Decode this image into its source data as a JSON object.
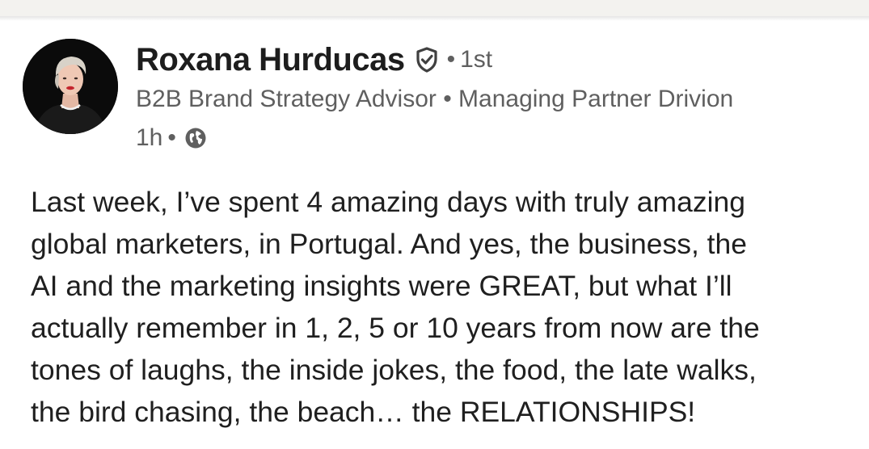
{
  "author": {
    "name": "Roxana Hurducas",
    "verified_icon": "verified-shield-icon",
    "separator": "•",
    "connection_degree": "1st",
    "headline": "B2B Brand Strategy Advisor • Managing Partner Drivion",
    "time_ago": "1h",
    "meta_separator": "•",
    "visibility_icon": "globe-icon"
  },
  "post": {
    "lines": [
      "Last week, I’ve spent 4 amazing days with truly amazing",
      "global marketers, in Portugal. And yes, the business, the",
      "AI and the marketing insights were GREAT, but what I’ll",
      "actually remember in 1, 2, 5 or 10 years from now are the",
      "tones of laughs, the inside jokes, the food, the late walks,",
      "the bird chasing, the beach… the RELATIONSHIPS!"
    ]
  }
}
